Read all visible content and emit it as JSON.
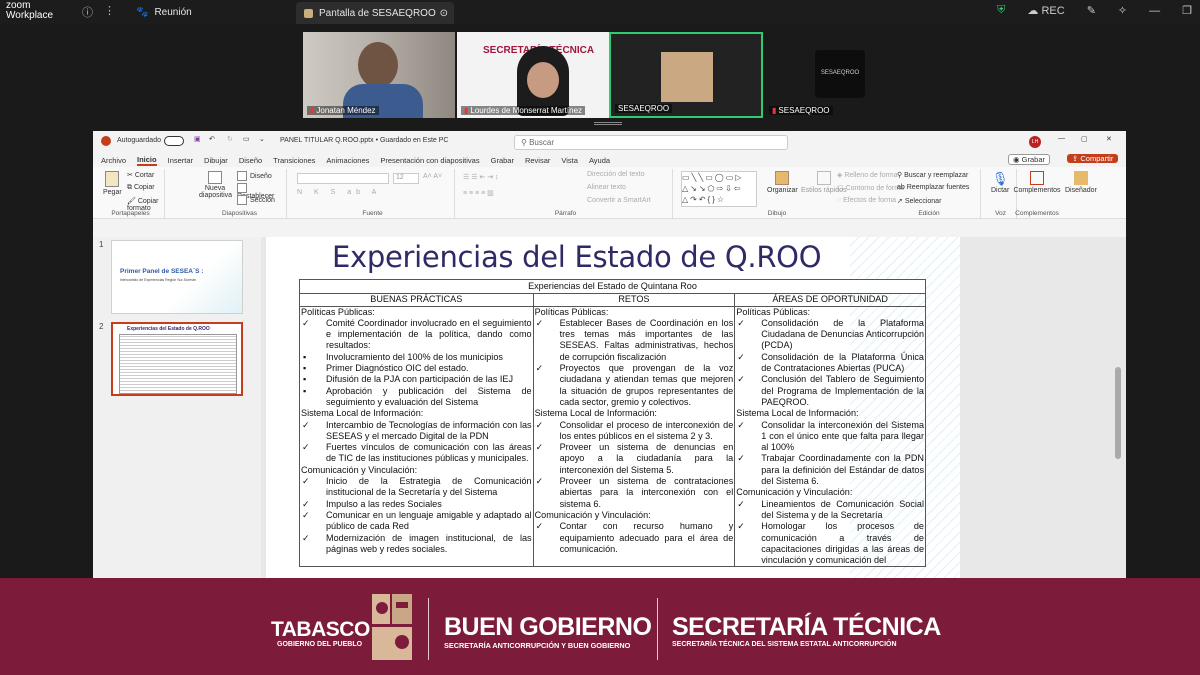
{
  "zoom": {
    "brand_line1": "zoom",
    "brand_line2": "Workplace",
    "tab_meeting": "Reunión",
    "tab_share": "Pantalla de SESAEQROO",
    "rec": "REC"
  },
  "gallery": {
    "participants": [
      "Jonatan Méndez",
      "Lourdes de Monserrat Martínez",
      "SESAEQROO",
      "SESAEQROO"
    ],
    "tile2_banner": "SECRETARÍA TÉCNICA",
    "avatar_text": "SESAEQROO"
  },
  "ppt": {
    "autosave": "Autoguardado",
    "filename": "PANEL TITULAR Q.ROO.pptx • Guardado en Este PC",
    "search_placeholder": "Buscar",
    "user_initials": "LH",
    "menu": [
      "Archivo",
      "Inicio",
      "Insertar",
      "Dibujar",
      "Diseño",
      "Transiciones",
      "Animaciones",
      "Presentación con diapositivas",
      "Grabar",
      "Revisar",
      "Vista",
      "Ayuda"
    ],
    "grabar_btn": "Grabar",
    "compartir_btn": "Compartir",
    "ribbon": {
      "pegar": "Pegar",
      "cortar": "Cortar",
      "copiar": "Copiar",
      "copiar_formato": "Copiar formato",
      "portapapeles": "Portapapeles",
      "nueva_diapositiva": "Nueva diapositiva",
      "diseno": "Diseño",
      "restablecer": "Restablecer",
      "seccion": "Sección",
      "diapositivas": "Diapositivas",
      "fuente_size": "12",
      "fuente": "Fuente",
      "direccion_texto": "Dirección del texto",
      "alinear_texto": "Alinear texto",
      "convertir_smartart": "Convertir a SmartArt",
      "parrafo": "Párrafo",
      "organizar": "Organizar",
      "estilos_rapidos": "Estilos rápidos",
      "relleno": "Relleno de forma",
      "contorno": "Contorno de forma",
      "efectos": "Efectos de forma",
      "dibujo": "Dibujo",
      "buscar_reemplazar": "Buscar y reemplazar",
      "reemplazar_fuentes": "Reemplazar fuentes",
      "seleccionar": "Seleccionar",
      "edicion": "Edición",
      "dictar": "Dictar",
      "voz": "Voz",
      "complementos": "Complementos",
      "disenador": "Diseñador"
    },
    "thumbs": [
      {
        "num": "1",
        "title": "Primer Panel de SESEA´S :",
        "sub": "Intercambio de Experiencias Región Sur-Sureste."
      },
      {
        "num": "2",
        "title": "Experiencias del Estado de Q.ROO"
      }
    ],
    "slide": {
      "title": "Experiencias del Estado de Q.ROO",
      "table_title": "Experiencias del Estado de Quintana Roo",
      "headers": [
        "BUENAS PRÁCTICAS",
        "RETOS",
        "ÁREAS DE OPORTUNIDAD"
      ],
      "col1": [
        {
          "t": "h",
          "text": "Políticas Públicas:"
        },
        {
          "t": "c",
          "text": "Comité Coordinador involucrado en el seguimiento e implementación de la política, dando como resultados:"
        },
        {
          "t": "s",
          "text": "Involucramiento del 100% de los municipios"
        },
        {
          "t": "s",
          "text": "Primer Diagnóstico OIC del estado."
        },
        {
          "t": "s",
          "text": "Difusión de la PJA con participación de las IEJ"
        },
        {
          "t": "s",
          "text": "Aprobación y publicación del Sistema de seguimiento y evaluación del Sistema"
        },
        {
          "t": "h",
          "text": "Sistema Local de Información:"
        },
        {
          "t": "c",
          "text": "Intercambio de Tecnologías de información con las SESEAS y el mercado Digital de la PDN"
        },
        {
          "t": "c",
          "text": "Fuertes vínculos de comunicación con las áreas de TIC de las instituciones públicas y municipales."
        },
        {
          "t": "h",
          "text": "Comunicación y Vinculación:"
        },
        {
          "t": "c",
          "text": "Inicio de la Estrategia de Comunicación institucional de la Secretaría y del Sistema"
        },
        {
          "t": "c",
          "text": "Impulso a las redes Sociales"
        },
        {
          "t": "c",
          "text": "Comunicar en un lenguaje amigable y adaptado al público de cada Red"
        },
        {
          "t": "c",
          "text": "Modernización de imagen institucional, de las páginas web y redes sociales."
        }
      ],
      "col2": [
        {
          "t": "h",
          "text": "Políticas Públicas:"
        },
        {
          "t": "c",
          "text": "Establecer Bases de Coordinación en los tres temas más importantes de las SESEAS. Faltas administrativas, hechos de corrupción fiscalización"
        },
        {
          "t": "c",
          "text": "Proyectos que provengan de la voz ciudadana y atiendan temas que mejoren la situación de grupos representantes de cada sector, gremio y colectivos."
        },
        {
          "t": "h",
          "text": "Sistema Local de Información:"
        },
        {
          "t": "c",
          "text": "Consolidar el proceso de interconexión de los entes públicos en el sistema 2 y 3."
        },
        {
          "t": "c",
          "text": "Proveer un sistema de denuncias en apoyo a la ciudadanía para la interconexión del Sistema 5."
        },
        {
          "t": "c",
          "text": "Proveer un sistema de contrataciones abiertas para la interconexión con el sistema 6."
        },
        {
          "t": "h",
          "text": "Comunicación y Vinculación:"
        },
        {
          "t": "c",
          "text": "Contar con recurso humano y equipamiento adecuado para el área de comunicación."
        }
      ],
      "col3": [
        {
          "t": "h",
          "text": "Políticas Públicas:"
        },
        {
          "t": "c",
          "text": "Consolidación de la Plataforma Ciudadana de Denuncias Anticorrupción (PCDA)"
        },
        {
          "t": "c",
          "text": "Consolidación de la Plataforma Única de Contrataciones Abiertas (PUCA)"
        },
        {
          "t": "c",
          "text": "Conclusión del Tablero de Seguimiento del Programa de Implementación de la PAEQROO."
        },
        {
          "t": "h",
          "text": "Sistema Local de Información:"
        },
        {
          "t": "c",
          "text": "Consolidar la interconexión del Sistema 1 con el único ente que falta para llegar al 100%"
        },
        {
          "t": "c",
          "text": "Trabajar Coordinadamente con la PDN para la definición del Estándar de datos del Sistema 6."
        },
        {
          "t": "h",
          "text": "Comunicación y Vinculación:"
        },
        {
          "t": "c",
          "text": "Lineamientos de Comunicación Social del Sistema y de la Secretaría"
        },
        {
          "t": "c",
          "text": "Homologar los procesos de comunicación a través de capacitaciones dirigidas a las áreas de vinculación y comunicación del"
        }
      ]
    }
  },
  "banner": {
    "tabasco": "TABASCO",
    "tabasco_sub": "GOBIERNO DEL PUEBLO",
    "buen_gobierno": "BUEN GOBIERNO",
    "buen_gobierno_sub": "SECRETARÍA ANTICORRUPCIÓN Y BUEN GOBIERNO",
    "sec_tecnica": "SECRETARÍA TÉCNICA",
    "sec_tecnica_sub": "SECRETARÍA TÉCNICA DEL SISTEMA ESTATAL ANTICORRUPCIÓN"
  },
  "colors": {
    "banner": "#7d1b3b",
    "ppt_accent": "#c43e1c",
    "slide_title": "#2e2a66",
    "zoom_bg": "#1a1a1a"
  }
}
